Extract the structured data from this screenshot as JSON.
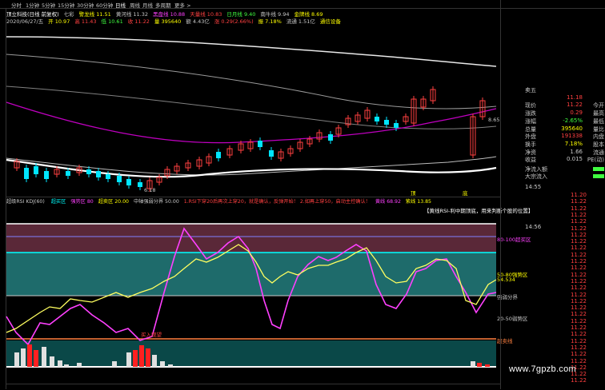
{
  "toolbar": {
    "items": [
      "分时",
      "1分钟",
      "5分钟",
      "15分钟",
      "30分钟",
      "60分钟",
      "日线",
      "周线",
      "月线",
      "多周期",
      "更多 >"
    ],
    "active_index": 6
  },
  "header": {
    "line1": [
      {
        "text": "顶立科技(日线 前复权)",
        "color": "#ffffff"
      },
      {
        "text": "七彩",
        "color": "#c8c8c8"
      },
      {
        "text": "警龙线 11.51",
        "color": "#ffff00"
      },
      {
        "text": "黄河线 11.32",
        "color": "#c8c8c8"
      },
      {
        "text": "黑盘线 10.88",
        "color": "#ff40ff"
      },
      {
        "text": "天量线 10.83",
        "color": "#ff4040"
      },
      {
        "text": "日月线 9.40",
        "color": "#40ff40"
      },
      {
        "text": "南牛线 9.94",
        "color": "#c8c8c8"
      },
      {
        "text": "金牌线 8.69",
        "color": "#ffff00"
      }
    ],
    "line2": [
      {
        "text": "2020/06/27/五",
        "color": "#c8c8c8"
      },
      {
        "text": "开 10.97",
        "color": "#ffff00"
      },
      {
        "text": "高 11.43",
        "color": "#ff4040"
      },
      {
        "text": "低 10.61",
        "color": "#40ff40"
      },
      {
        "text": "收 11.22",
        "color": "#ff4040"
      },
      {
        "text": "量 395640",
        "color": "#ffff00"
      },
      {
        "text": "额 4.43亿",
        "color": "#c8c8c8"
      },
      {
        "text": "涨 0.29(2.66%)",
        "color": "#ff4040"
      },
      {
        "text": "振 7.18%",
        "color": "#ffff00"
      },
      {
        "text": "流通 1.51亿",
        "color": "#c8c8c8"
      },
      {
        "text": "通信设备",
        "color": "#ffff00"
      }
    ]
  },
  "chart_labels": {
    "low_marker": "6.18",
    "price_level": "8.65",
    "tag1": "顶",
    "tag2": "底"
  },
  "indicator": {
    "title": "超级RSI KDJ(60)",
    "items": [
      {
        "text": "超买区",
        "color": "#00ffff"
      },
      {
        "text": "强势区 80",
        "color": "#ff40ff"
      },
      {
        "text": "超卖区 20.00",
        "color": "#ffff00"
      },
      {
        "text": "中轴强弱分界 50.00",
        "color": "#c8c8c8"
      },
      {
        "text": "1.RSI下穿20后再次上穿20，就是确认，反弹开始！ 2.如再上穿50，启动主控确认！",
        "color": "#ff4040"
      },
      {
        "text": "黄线 68.92",
        "color": "#ff40ff"
      },
      {
        "text": "紫线 13.85",
        "color": "#ffff00"
      }
    ],
    "note": "【黄线RSI-利中期顶底，用来判断个股的位置】",
    "zones": [
      {
        "label": "80-100超买区",
        "color": "#ff40ff"
      },
      {
        "label": "50-80强势区",
        "color": "#ffff00"
      },
      {
        "label": "强弱分界",
        "color": "#c8c8c8"
      },
      {
        "label": "20-50弱势区",
        "color": "#c8c8c8"
      },
      {
        "label": "超卖线",
        "color": "#ff8040"
      }
    ],
    "val1": "54.534",
    "low_tag": "买入观望"
  },
  "right_panel": {
    "top": [
      {
        "label": "卖五",
        "value": "",
        "label2": "",
        "color": "#c8c8c8"
      },
      {
        "label": "",
        "value": "11.18",
        "label2": "",
        "color": "#ff4040"
      },
      {
        "label": "现价",
        "value": "11.22",
        "label2": "今开",
        "color": "#ff4040"
      },
      {
        "label": "涨跌",
        "value": "0.29",
        "label2": "最高",
        "color": "#ff4040"
      },
      {
        "label": "涨幅",
        "value": "-2.65%",
        "label2": "最低",
        "color": "#40ff40"
      },
      {
        "label": "总量",
        "value": "395640",
        "label2": "量比",
        "color": "#ffff00"
      },
      {
        "label": "外盘",
        "value": "191338",
        "label2": "内盘",
        "color": "#ff4040"
      },
      {
        "label": "换手",
        "value": "7.18%",
        "label2": "股本",
        "color": "#ffff00"
      },
      {
        "label": "净资",
        "value": "1.66",
        "label2": "流通",
        "color": "#c8c8c8"
      },
      {
        "label": "收益",
        "value": "0.015",
        "label2": "PE(动)",
        "color": "#c8c8c8"
      }
    ],
    "flow": [
      {
        "label": "净流入额",
        "color": "#c8c8c8",
        "value": "",
        "vcolor": "#40ff40"
      },
      {
        "label": "大宗流入",
        "color": "#c8c8c8",
        "value": "",
        "vcolor": "#40ff40"
      }
    ],
    "time": "14:55",
    "time2": "14:56",
    "ticks": [
      "11.20",
      "11.22",
      "11.22",
      "11.22",
      "11.22",
      "11.22",
      "11.22",
      "11.22",
      "11.22",
      "11.22",
      "11.22",
      "11.22",
      "11.22",
      "11.22",
      "11.22",
      "11.22",
      "11.22",
      "11.22",
      "11.22",
      "11.22",
      "11.22",
      "11.22",
      "11.22",
      "11.22",
      "11.22",
      "11.22",
      "11.22",
      "11.22",
      "11.22"
    ]
  },
  "watermark": "www.7gpzb.com"
}
